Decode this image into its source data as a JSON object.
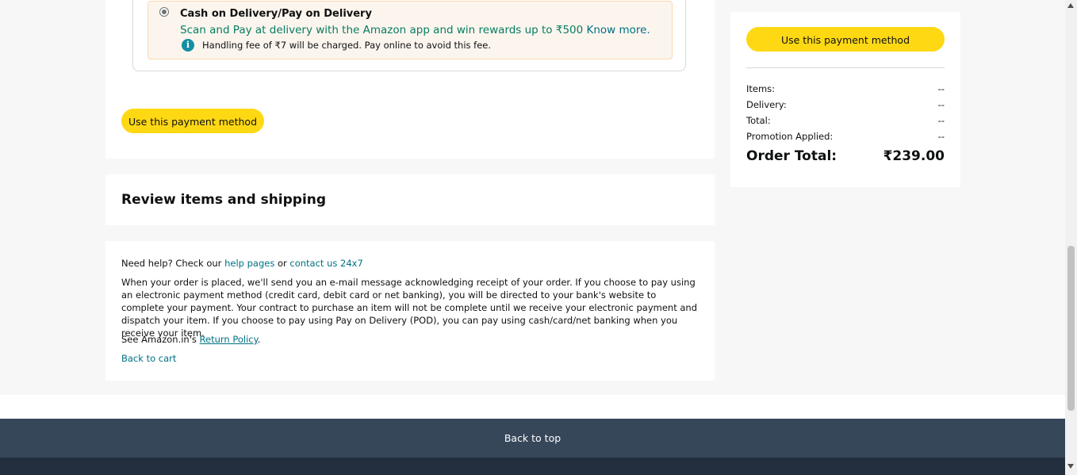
{
  "payment": {
    "cod_title": "Cash on Delivery/Pay on Delivery",
    "cod_promo": "Scan and Pay at delivery with the Amazon app and win rewards up to ₹500",
    "cod_know_more": "Know more.",
    "info_icon_glyph": "i",
    "cod_fee_note": "Handling fee of ₹7 will be charged. Pay online to avoid this fee.",
    "use_button_label": "Use this payment method"
  },
  "review": {
    "title": "Review items and shipping"
  },
  "help": {
    "prefix": "Need help? Check our ",
    "help_pages_link": "help pages",
    "or_text": " or ",
    "contact_link": "contact us 24x7",
    "paragraph": "When your order is placed, we'll send you an e-mail message acknowledging receipt of your order. If you choose to pay using an electronic payment method (credit card, debit card or net banking), you will be directed to your bank's website to complete your payment. Your contract to purchase an item will not be complete until we receive your electronic payment and dispatch your item. If you choose to pay using Pay on Delivery (POD), you can pay using cash/card/net banking when you receive your item.",
    "return_prefix": "See Amazon.in's ",
    "return_link": "Return Policy",
    "return_suffix": ".",
    "back_to_cart": "Back to cart"
  },
  "summary": {
    "use_button_label": "Use this payment method",
    "rows": [
      {
        "label": "Items:",
        "value": "--"
      },
      {
        "label": "Delivery:",
        "value": "--"
      },
      {
        "label": "Total:",
        "value": "--"
      },
      {
        "label": "Promotion Applied:",
        "value": "--"
      }
    ],
    "order_total_label": "Order Total:",
    "order_total_value": "₹239.00"
  },
  "footer": {
    "back_to_top": "Back to top"
  },
  "colors": {
    "button_yellow": "#ffd814",
    "link_teal": "#007185",
    "promo_green": "#067d62",
    "footer_top": "#37475a",
    "footer_dark": "#232f3e"
  }
}
